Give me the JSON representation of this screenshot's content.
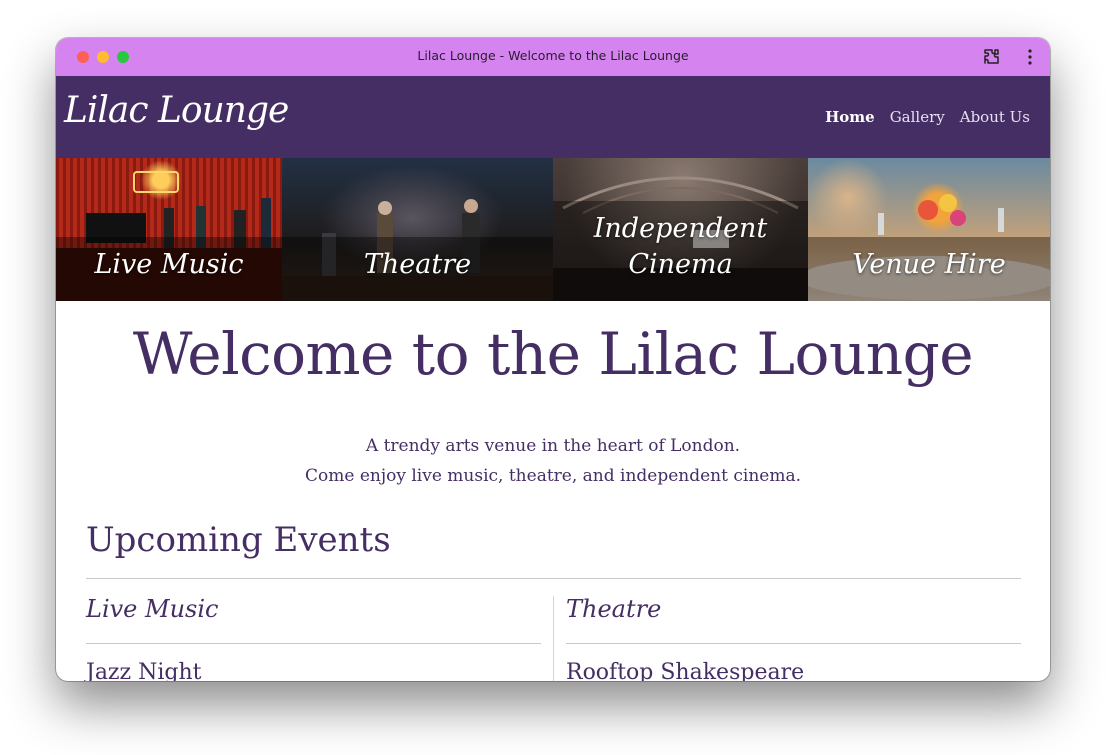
{
  "window": {
    "title": "Lilac Lounge - Welcome to the Lilac Lounge",
    "colors": {
      "titlebar": "#d584ef",
      "navbar": "#442e63",
      "accent": "#442e63"
    }
  },
  "nav": {
    "brand": "Lilac Lounge",
    "links": [
      "Home",
      "Gallery",
      "About Us"
    ],
    "active": "Home"
  },
  "banner": {
    "tiles": [
      "Live Music",
      "Theatre",
      "Independent Cinema",
      "Venue Hire"
    ]
  },
  "main": {
    "heading": "Welcome to the Lilac Lounge",
    "intro_line1": "A trendy arts venue in the heart of London.",
    "intro_line2": "Come enjoy live music, theatre, and independent cinema.",
    "section_title": "Upcoming Events",
    "columns": [
      {
        "title": "Live Music",
        "first_event": "Jazz Night"
      },
      {
        "title": "Theatre",
        "first_event": "Rooftop Shakespeare"
      }
    ]
  }
}
